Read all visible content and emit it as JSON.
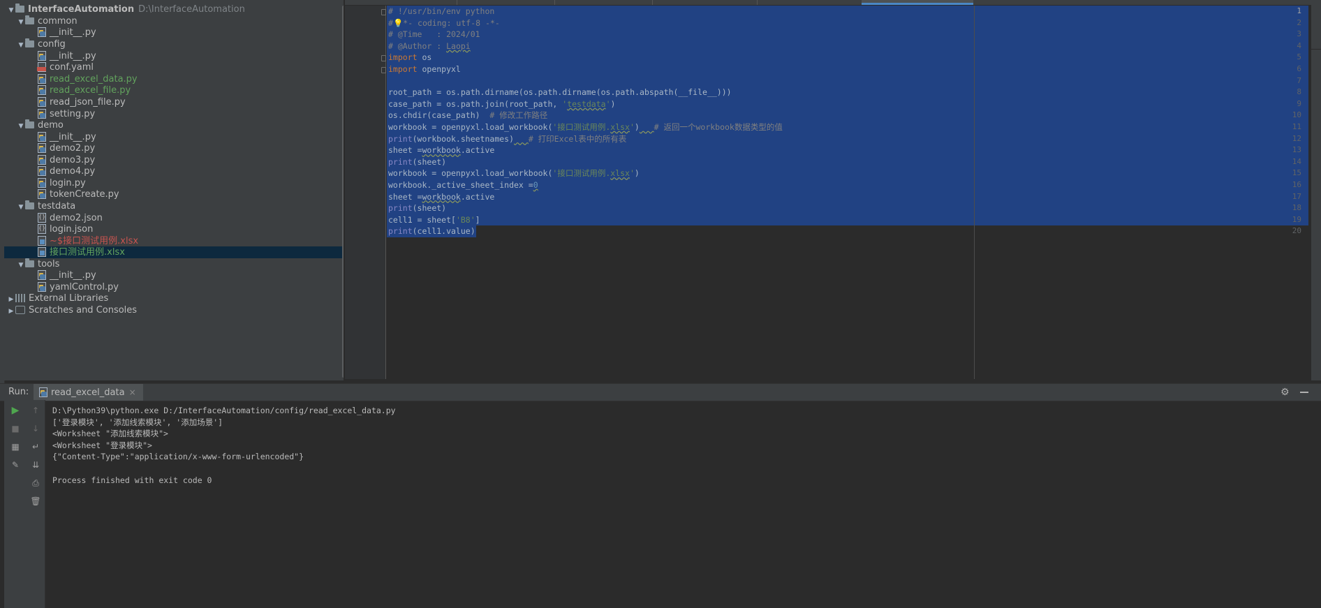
{
  "project": {
    "items": [
      {
        "label": "InterfaceAutomation",
        "path": "D:\\InterfaceAutomation",
        "kind": "root"
      },
      {
        "label": "common"
      },
      {
        "label": "__init__.py"
      },
      {
        "label": "config"
      },
      {
        "label": "__init__.py"
      },
      {
        "label": "conf.yaml"
      },
      {
        "label": "read_excel_data.py"
      },
      {
        "label": "read_excel_file.py"
      },
      {
        "label": "read_json_file.py"
      },
      {
        "label": "setting.py"
      },
      {
        "label": "demo"
      },
      {
        "label": "__init__.py"
      },
      {
        "label": "demo2.py"
      },
      {
        "label": "demo3.py"
      },
      {
        "label": "demo4.py"
      },
      {
        "label": "login.py"
      },
      {
        "label": "tokenCreate.py"
      },
      {
        "label": "testdata"
      },
      {
        "label": "demo2.json"
      },
      {
        "label": "login.json"
      },
      {
        "label": "~$接口测试用例.xlsx"
      },
      {
        "label": "接口测试用例.xlsx"
      },
      {
        "label": "tools"
      },
      {
        "label": "__init__.py"
      },
      {
        "label": "yamlControl.py"
      },
      {
        "label": "External Libraries"
      },
      {
        "label": "Scratches and Consoles"
      }
    ]
  },
  "editor": {
    "line_numbers": [
      "1",
      "2",
      "3",
      "4",
      "5",
      "6",
      "7",
      "8",
      "9",
      "10",
      "11",
      "12",
      "13",
      "14",
      "15",
      "16",
      "17",
      "18",
      "19",
      "20"
    ],
    "lines": [
      [
        {
          "t": "# !/usr/bin/env python",
          "c": "cmt"
        }
      ],
      [
        {
          "t": "#",
          "c": "cmt"
        },
        {
          "t": "💡",
          "c": "cmt"
        },
        {
          "t": "*- coding: utf-8 -*-",
          "c": "cmt"
        }
      ],
      [
        {
          "t": "# @Time   : 2024/01",
          "c": "cmt"
        }
      ],
      [
        {
          "t": "# @Author : ",
          "c": "cmt"
        },
        {
          "t": "Laopi",
          "c": "cmt sq"
        }
      ],
      [
        {
          "t": "import",
          "c": "kw"
        },
        {
          "t": " os",
          "c": ""
        }
      ],
      [
        {
          "t": "import",
          "c": "kw"
        },
        {
          "t": " openpyxl",
          "c": ""
        }
      ],
      [
        {
          "t": "",
          "c": ""
        }
      ],
      [
        {
          "t": "root_path = os.path.dirname(os.path.dirname(os.path.abspath(__file__)))",
          "c": ""
        }
      ],
      [
        {
          "t": "case_path = os.path.join(root_path, ",
          "c": ""
        },
        {
          "t": "'",
          "c": "str"
        },
        {
          "t": "testdata",
          "c": "str sq"
        },
        {
          "t": "'",
          "c": "str"
        },
        {
          "t": ")",
          "c": ""
        }
      ],
      [
        {
          "t": "os.chdir(case_path)  ",
          "c": ""
        },
        {
          "t": "# 修改工作路径",
          "c": "cmt"
        }
      ],
      [
        {
          "t": "workbook = openpyxl.load_workbook(",
          "c": ""
        },
        {
          "t": "'接口测试用例.",
          "c": "str"
        },
        {
          "t": "xlsx",
          "c": "str sq"
        },
        {
          "t": "'",
          "c": "str"
        },
        {
          "t": ")",
          "c": ""
        },
        {
          "t": "   ",
          "c": "sq"
        },
        {
          "t": "# 返回一个workbook数据类型的值",
          "c": "cmt"
        }
      ],
      [
        {
          "t": "print",
          "c": "bi"
        },
        {
          "t": "(workbook.sheetnames)",
          "c": ""
        },
        {
          "t": "   ",
          "c": "sq"
        },
        {
          "t": "# 打印Excel表中的所有表",
          "c": "cmt"
        }
      ],
      [
        {
          "t": "sheet =",
          "c": ""
        },
        {
          "t": "workbook",
          "c": "sq"
        },
        {
          "t": ".active",
          "c": ""
        }
      ],
      [
        {
          "t": "print",
          "c": "bi"
        },
        {
          "t": "(sheet)",
          "c": ""
        }
      ],
      [
        {
          "t": "workbook = openpyxl.load_workbook(",
          "c": ""
        },
        {
          "t": "'接口测试用例.",
          "c": "str"
        },
        {
          "t": "xlsx",
          "c": "str sq"
        },
        {
          "t": "'",
          "c": "str"
        },
        {
          "t": ")",
          "c": ""
        }
      ],
      [
        {
          "t": "workbook._active_sheet_index =",
          "c": ""
        },
        {
          "t": "0",
          "c": "num sq"
        }
      ],
      [
        {
          "t": "sheet =",
          "c": ""
        },
        {
          "t": "workbook",
          "c": "sq"
        },
        {
          "t": ".active",
          "c": ""
        }
      ],
      [
        {
          "t": "print",
          "c": "bi"
        },
        {
          "t": "(sheet)",
          "c": ""
        }
      ],
      [
        {
          "t": "cell1 = sheet[",
          "c": ""
        },
        {
          "t": "'B8'",
          "c": "str"
        },
        {
          "t": "]",
          "c": ""
        }
      ],
      [
        {
          "t": "print",
          "c": "bi"
        },
        {
          "t": "(cell1.value)",
          "c": ""
        }
      ]
    ]
  },
  "run": {
    "label": "Run:",
    "tab_label": "read_excel_data",
    "close": "×",
    "output": [
      "D:\\Python39\\python.exe D:/InterfaceAutomation/config/read_excel_data.py",
      "['登录模块', '添加线索模块', '添加场景']",
      "<Worksheet \"添加线索模块\">",
      "<Worksheet \"登录模块\">",
      "{\"Content-Type\":\"application/x-www-form-urlencoded\"}",
      "",
      "Process finished with exit code 0"
    ]
  },
  "colors": {
    "selection": "#214283",
    "panel": "#3c3f41",
    "editor_bg": "#2b2b2b",
    "keyword": "#cc7832",
    "string": "#6a8759",
    "comment": "#808080",
    "builtin": "#8888c6",
    "vcs_added": "#62a35d",
    "vcs_unversioned": "#c75450",
    "selected_row": "#0d293e"
  },
  "icons": [
    "folder-icon",
    "python-file-icon",
    "yaml-file-icon",
    "json-file-icon",
    "xlsx-file-icon",
    "library-icon",
    "scratches-icon",
    "run-icon",
    "stop-icon",
    "settings-icon",
    "minimize-icon"
  ]
}
